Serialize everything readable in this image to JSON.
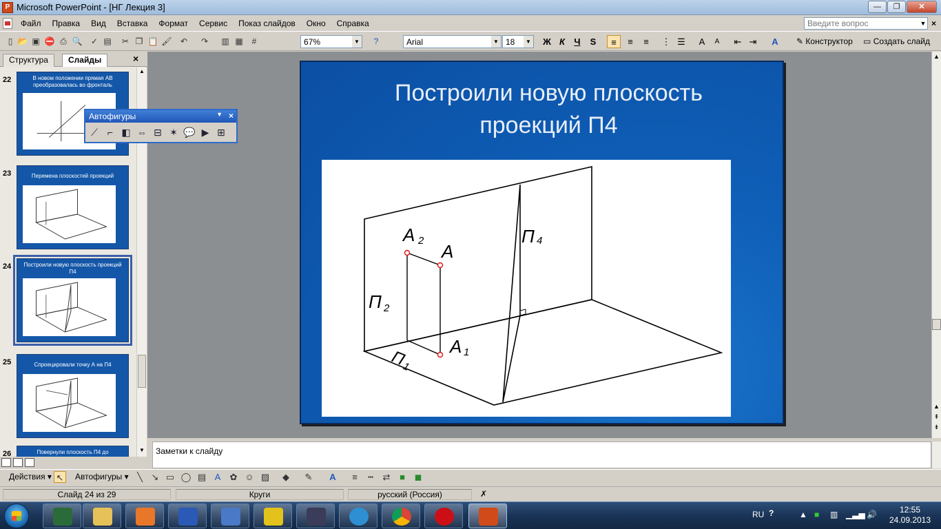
{
  "window": {
    "app_title": "Microsoft PowerPoint - [НГ Лекция 3]",
    "minimize": "—",
    "restore": "❐",
    "close": "✕"
  },
  "menu": {
    "items": [
      "Файл",
      "Правка",
      "Вид",
      "Вставка",
      "Формат",
      "Сервис",
      "Показ слайдов",
      "Окно",
      "Справка"
    ],
    "help_placeholder": "Введите вопрос",
    "close": "×"
  },
  "toolbar": {
    "zoom": "67%",
    "font_name": "Arial",
    "font_size": "18",
    "bold": "Ж",
    "italic": "К",
    "underline": "Ч",
    "shadow": "S",
    "designer": "Конструктор",
    "new_slide": "Создать слайд"
  },
  "left_pane": {
    "tabs": [
      "Структура",
      "Слайды"
    ],
    "close": "×",
    "slides": [
      {
        "num": "22",
        "title": "В новом положении прямая АВ преобразовалась во фронталь"
      },
      {
        "num": "23",
        "title": "Перемена плоскостей проекций"
      },
      {
        "num": "24",
        "title": "Построили новую плоскость проекций П4"
      },
      {
        "num": "25",
        "title": "Спроецировали точку А на П4"
      },
      {
        "num": "26",
        "title": "Повернули плоскость П4 до"
      }
    ]
  },
  "autoshapes_toolbar": {
    "title": "Автофигуры",
    "close": "×"
  },
  "slide": {
    "title": "Построили новую плоскость проекций П4",
    "labels": {
      "a2": "A",
      "a2_sub": "2",
      "a": "A",
      "a1": "A",
      "a1_sub": "1",
      "p2": "П",
      "p2_sub": "2",
      "p4": "П",
      "p4_sub": "4",
      "p1": "П",
      "p1_sub": "1"
    }
  },
  "notes": {
    "placeholder": "Заметки к слайду"
  },
  "drawing_toolbar": {
    "actions": "Действия",
    "autoshapes": "Автофигуры"
  },
  "status": {
    "slide_counter": "Слайд 24 из 29",
    "design": "Круги",
    "language": "русский (Россия)"
  },
  "taskbar": {
    "lang": "RU",
    "time": "12:55",
    "date": "24.09.2013"
  }
}
